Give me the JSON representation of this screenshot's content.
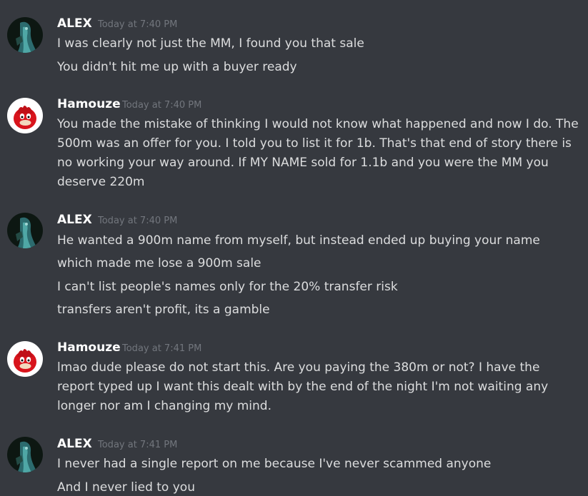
{
  "colors": {
    "background": "#36393f",
    "author_name": "#ffffff",
    "message_text": "#dcddde",
    "timestamp": "#72767d"
  },
  "users": {
    "alex": {
      "name": "ALEX",
      "avatar_icon": "anime-character-avatar-icon"
    },
    "hamouze": {
      "name": "Hamouze",
      "avatar_icon": "red-knuckles-avatar-icon"
    }
  },
  "messages": [
    {
      "author": "ALEX",
      "timestamp": "Today at 7:40 PM",
      "lines": [
        "I was clearly not just the MM, I found you that sale",
        "You didn't hit me up with a buyer ready"
      ]
    },
    {
      "author": "Hamouze",
      "timestamp": "Today at 7:40 PM",
      "lines": [
        "You made the mistake of thinking I would not know what happened and now I do. The 500m was an offer for you. I told you to list it for 1b. That's that end of story there is no working your way around. If MY NAME sold for 1.1b and you were the MM you deserve 220m"
      ]
    },
    {
      "author": "ALEX",
      "timestamp": "Today at 7:40 PM",
      "lines": [
        "He wanted a 900m name from myself, but instead ended up buying your name",
        "which made me lose a 900m sale",
        "I can't list people's names only for the 20% transfer risk",
        "transfers aren't profit, its a gamble"
      ]
    },
    {
      "author": "Hamouze",
      "timestamp": "Today at 7:41 PM",
      "lines": [
        "lmao dude please do not start this. Are you paying the 380m or not? I have the report typed up I want this dealt with by the end of the night I'm not waiting any longer nor am I changing my mind."
      ]
    },
    {
      "author": "ALEX",
      "timestamp": "Today at 7:41 PM",
      "lines": [
        "I never had a single report on me because I've never scammed anyone",
        "And I never lied to you"
      ]
    }
  ]
}
